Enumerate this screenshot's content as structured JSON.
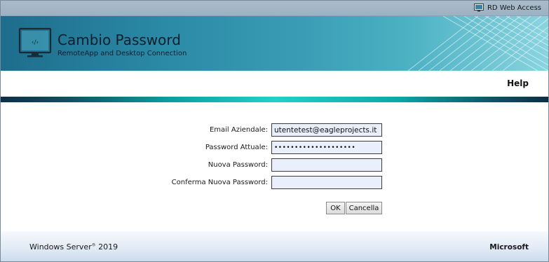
{
  "topbar": {
    "link_label": "RD Web Access",
    "icon": "monitor-icon"
  },
  "header": {
    "title": "Cambio Password",
    "subtitle": "RemoteApp and Desktop Connection",
    "icon": "remote-desktop-monitor-icon"
  },
  "nav": {
    "help_label": "Help"
  },
  "form": {
    "email_label": "Email Aziendale:",
    "email_value": "utentetest@eagleprojects.it",
    "current_password_label": "Password Attuale:",
    "current_password_value": "••••••••••••••••••••",
    "new_password_label": "Nuova Password:",
    "new_password_value": "",
    "confirm_password_label": "Conferma Nuova Password:",
    "confirm_password_value": "",
    "ok_label": "OK",
    "cancel_label": "Cancella"
  },
  "footer": {
    "windows_server": "Windows Server",
    "windows_server_reg": "®",
    "windows_server_year": " 2019",
    "microsoft": "Microsoft"
  },
  "colors": {
    "header_dark": "#1d6d8c",
    "header_light": "#8ad4df",
    "accent_cyan": "#1ed2c8",
    "input_bg": "#e9f0fb"
  }
}
